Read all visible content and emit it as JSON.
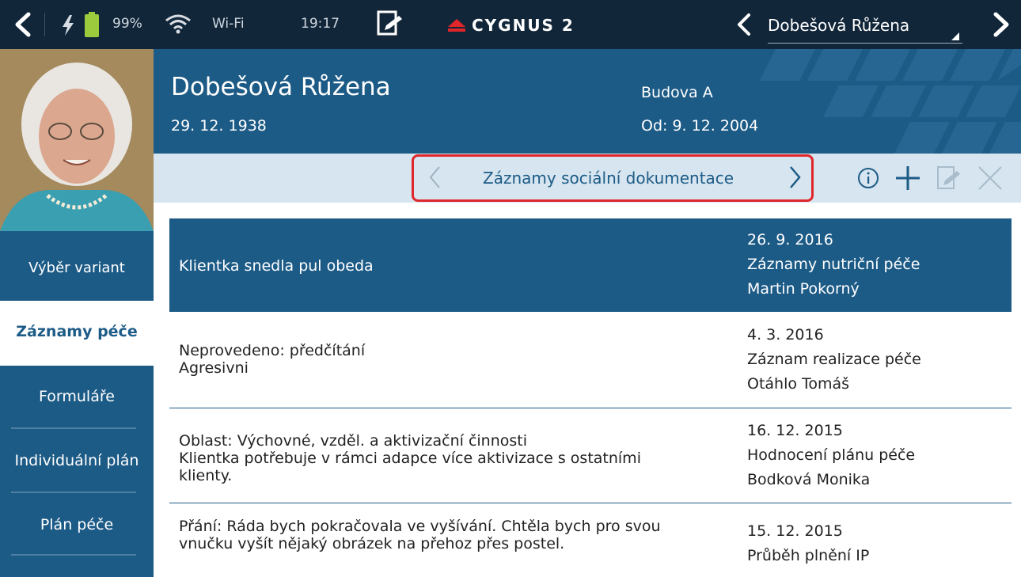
{
  "status_bar": {
    "battery": "99%",
    "wifi": "Wi-Fi",
    "time": "19:17",
    "logo_text": "CYGNUS 2",
    "patient_selector": "Dobešová Růžena"
  },
  "header": {
    "name": "Dobešová Růžena",
    "dob": "29. 12. 1938",
    "building": "Budova A",
    "since": "Od: 9. 12. 2004"
  },
  "navbar": {
    "title": "Záznamy sociální dokumentace"
  },
  "sidebar": {
    "variant": "Výběr variant",
    "items": [
      {
        "label": "Záznamy péče"
      },
      {
        "label": "Formuláře"
      },
      {
        "label": "Individuální plán"
      },
      {
        "label": "Plán péče"
      }
    ]
  },
  "records": [
    {
      "lines": [
        "Klientka snedla pul obeda"
      ],
      "date": "26. 9. 2016",
      "type": "Záznamy nutriční péče",
      "author": "Martin Pokorný"
    },
    {
      "lines": [
        "Neprovedeno: předčítání",
        "Agresivni"
      ],
      "date": "4. 3. 2016",
      "type": "Záznam realizace péče",
      "author": "Otáhlo Tomáš"
    },
    {
      "lines": [
        "Oblast: Výchovné, vzděl. a aktivizační činnosti",
        "Klientka potřebuje v rámci adapce více aktivizace s ostatními",
        "klienty."
      ],
      "date": "16. 12. 2015",
      "type": "Hodnocení plánu péče",
      "author": "Bodková Monika"
    },
    {
      "lines": [
        "Přání: Ráda bych pokračovala ve vyšívání. Chtěla bych pro svou",
        "vnučku vyšít nějaký obrázek na přehoz přes postel."
      ],
      "date": "15. 12. 2015",
      "type": "Průběh plnění IP",
      "author": ""
    }
  ]
}
